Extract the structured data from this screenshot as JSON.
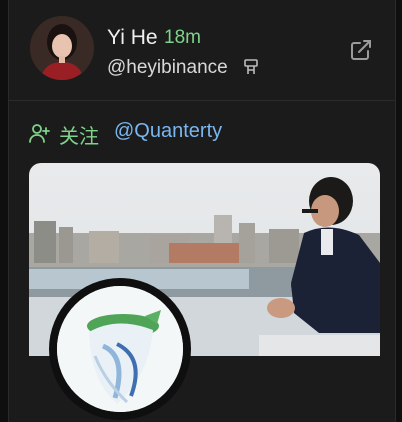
{
  "post": {
    "author_name": "Yi He",
    "time_ago": "18m",
    "handle": "@heyibinance",
    "action_label": "关注",
    "mention": "@Quanterty"
  },
  "icons": {
    "handle_badge": "moai-icon",
    "external": "external-link-icon",
    "follow": "add-user-icon"
  },
  "colors": {
    "accent_green": "#7fd38a",
    "mention_blue": "#7ab6ef",
    "card_bg": "#1b1b1c"
  }
}
